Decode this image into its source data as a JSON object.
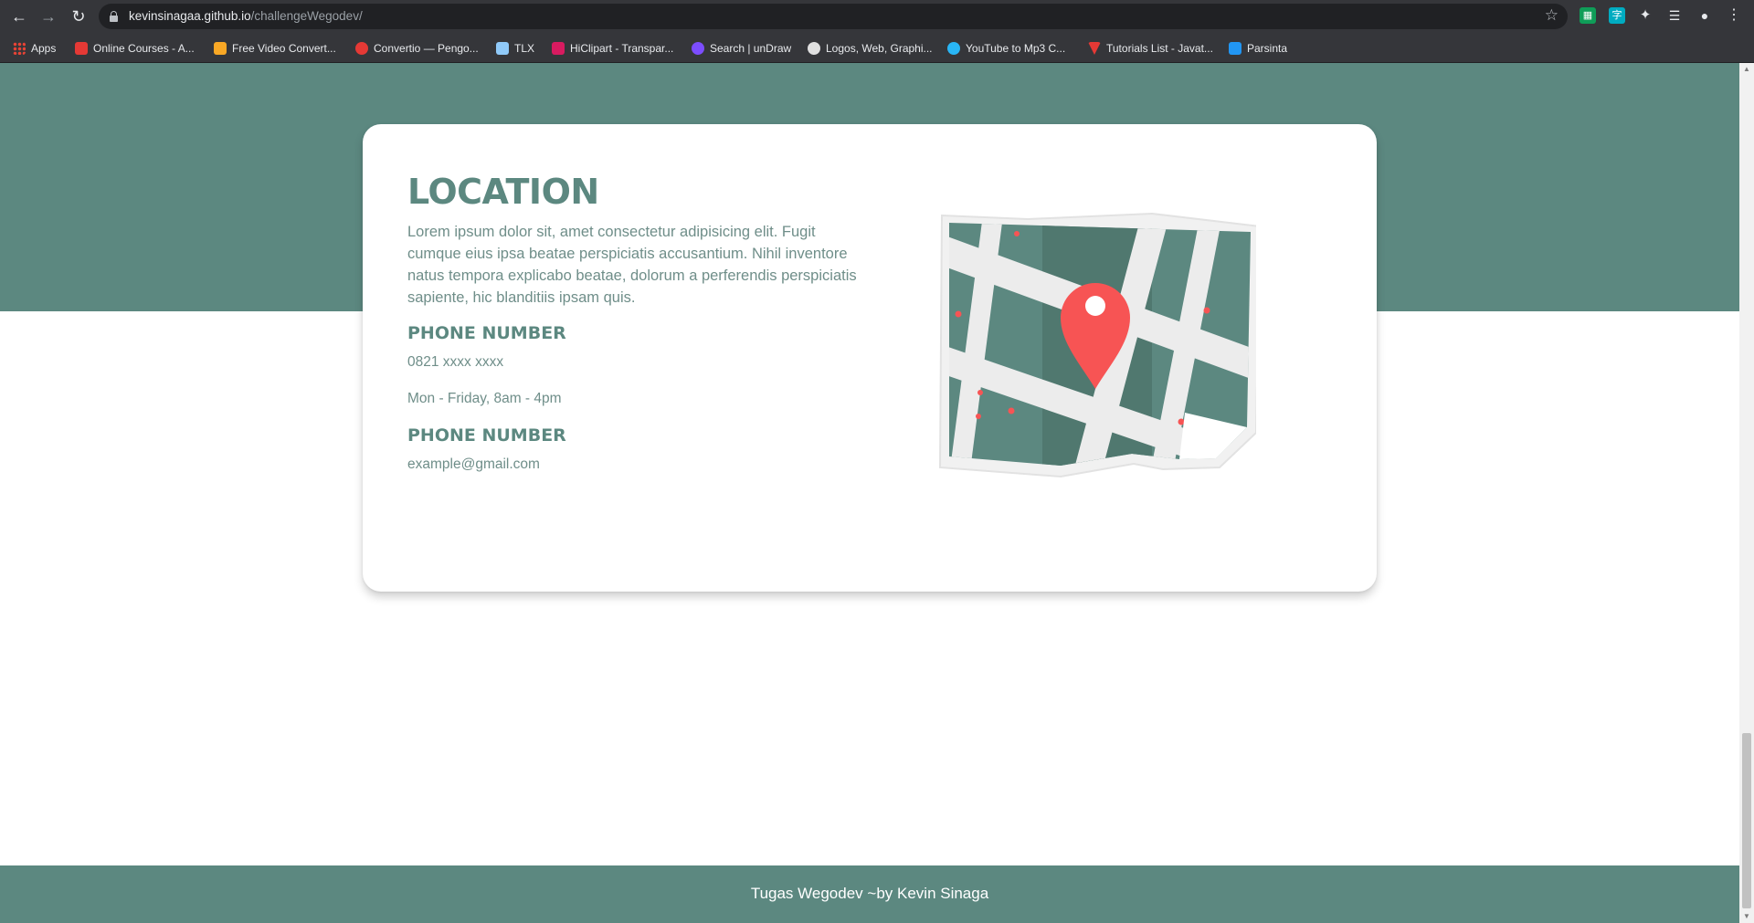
{
  "browser": {
    "url_host": "kevinsinagaa.github.io",
    "url_path": "/challengeWegodev/",
    "bookmarks": [
      {
        "label": "Apps",
        "color": "#ea4335"
      },
      {
        "label": "Online Courses - A...",
        "color": "#e53935"
      },
      {
        "label": "Free Video Convert...",
        "color": "#f9a825"
      },
      {
        "label": "Convertio — Pengo...",
        "color": "#e53935"
      },
      {
        "label": "TLX",
        "color": "#90caf9"
      },
      {
        "label": "HiClipart - Transpar...",
        "color": "#d81b60"
      },
      {
        "label": "Search | unDraw",
        "color": "#7c4dff"
      },
      {
        "label": "Logos, Web, Graphi...",
        "color": "#e0e0e0"
      },
      {
        "label": "YouTube to Mp3 C...",
        "color": "#29b6f6"
      },
      {
        "label": "Tutorials List - Javat...",
        "color": "#e53935"
      },
      {
        "label": "Parsinta",
        "color": "#2196f3"
      }
    ]
  },
  "location": {
    "title": "LOCATION",
    "description": "Lorem ipsum dolor sit, amet consectetur adipisicing elit. Fugit cumque eius ipsa beatae perspiciatis accusantium. Nihil inventore natus tempora explicabo beatae, dolorum a perferendis perspiciatis sapiente, hic blanditiis ipsam quis.",
    "phone_heading": "PHONE NUMBER",
    "phone": "0821 xxxx xxxx",
    "hours": "Mon - Friday, 8am - 4pm",
    "email_heading": "PHONE NUMBER",
    "email": "example@gmail.com"
  },
  "footer": {
    "text": "Tugas Wegodev ~by Kevin Sinaga"
  },
  "colors": {
    "primary": "#5c8880",
    "pin": "#f75454"
  }
}
